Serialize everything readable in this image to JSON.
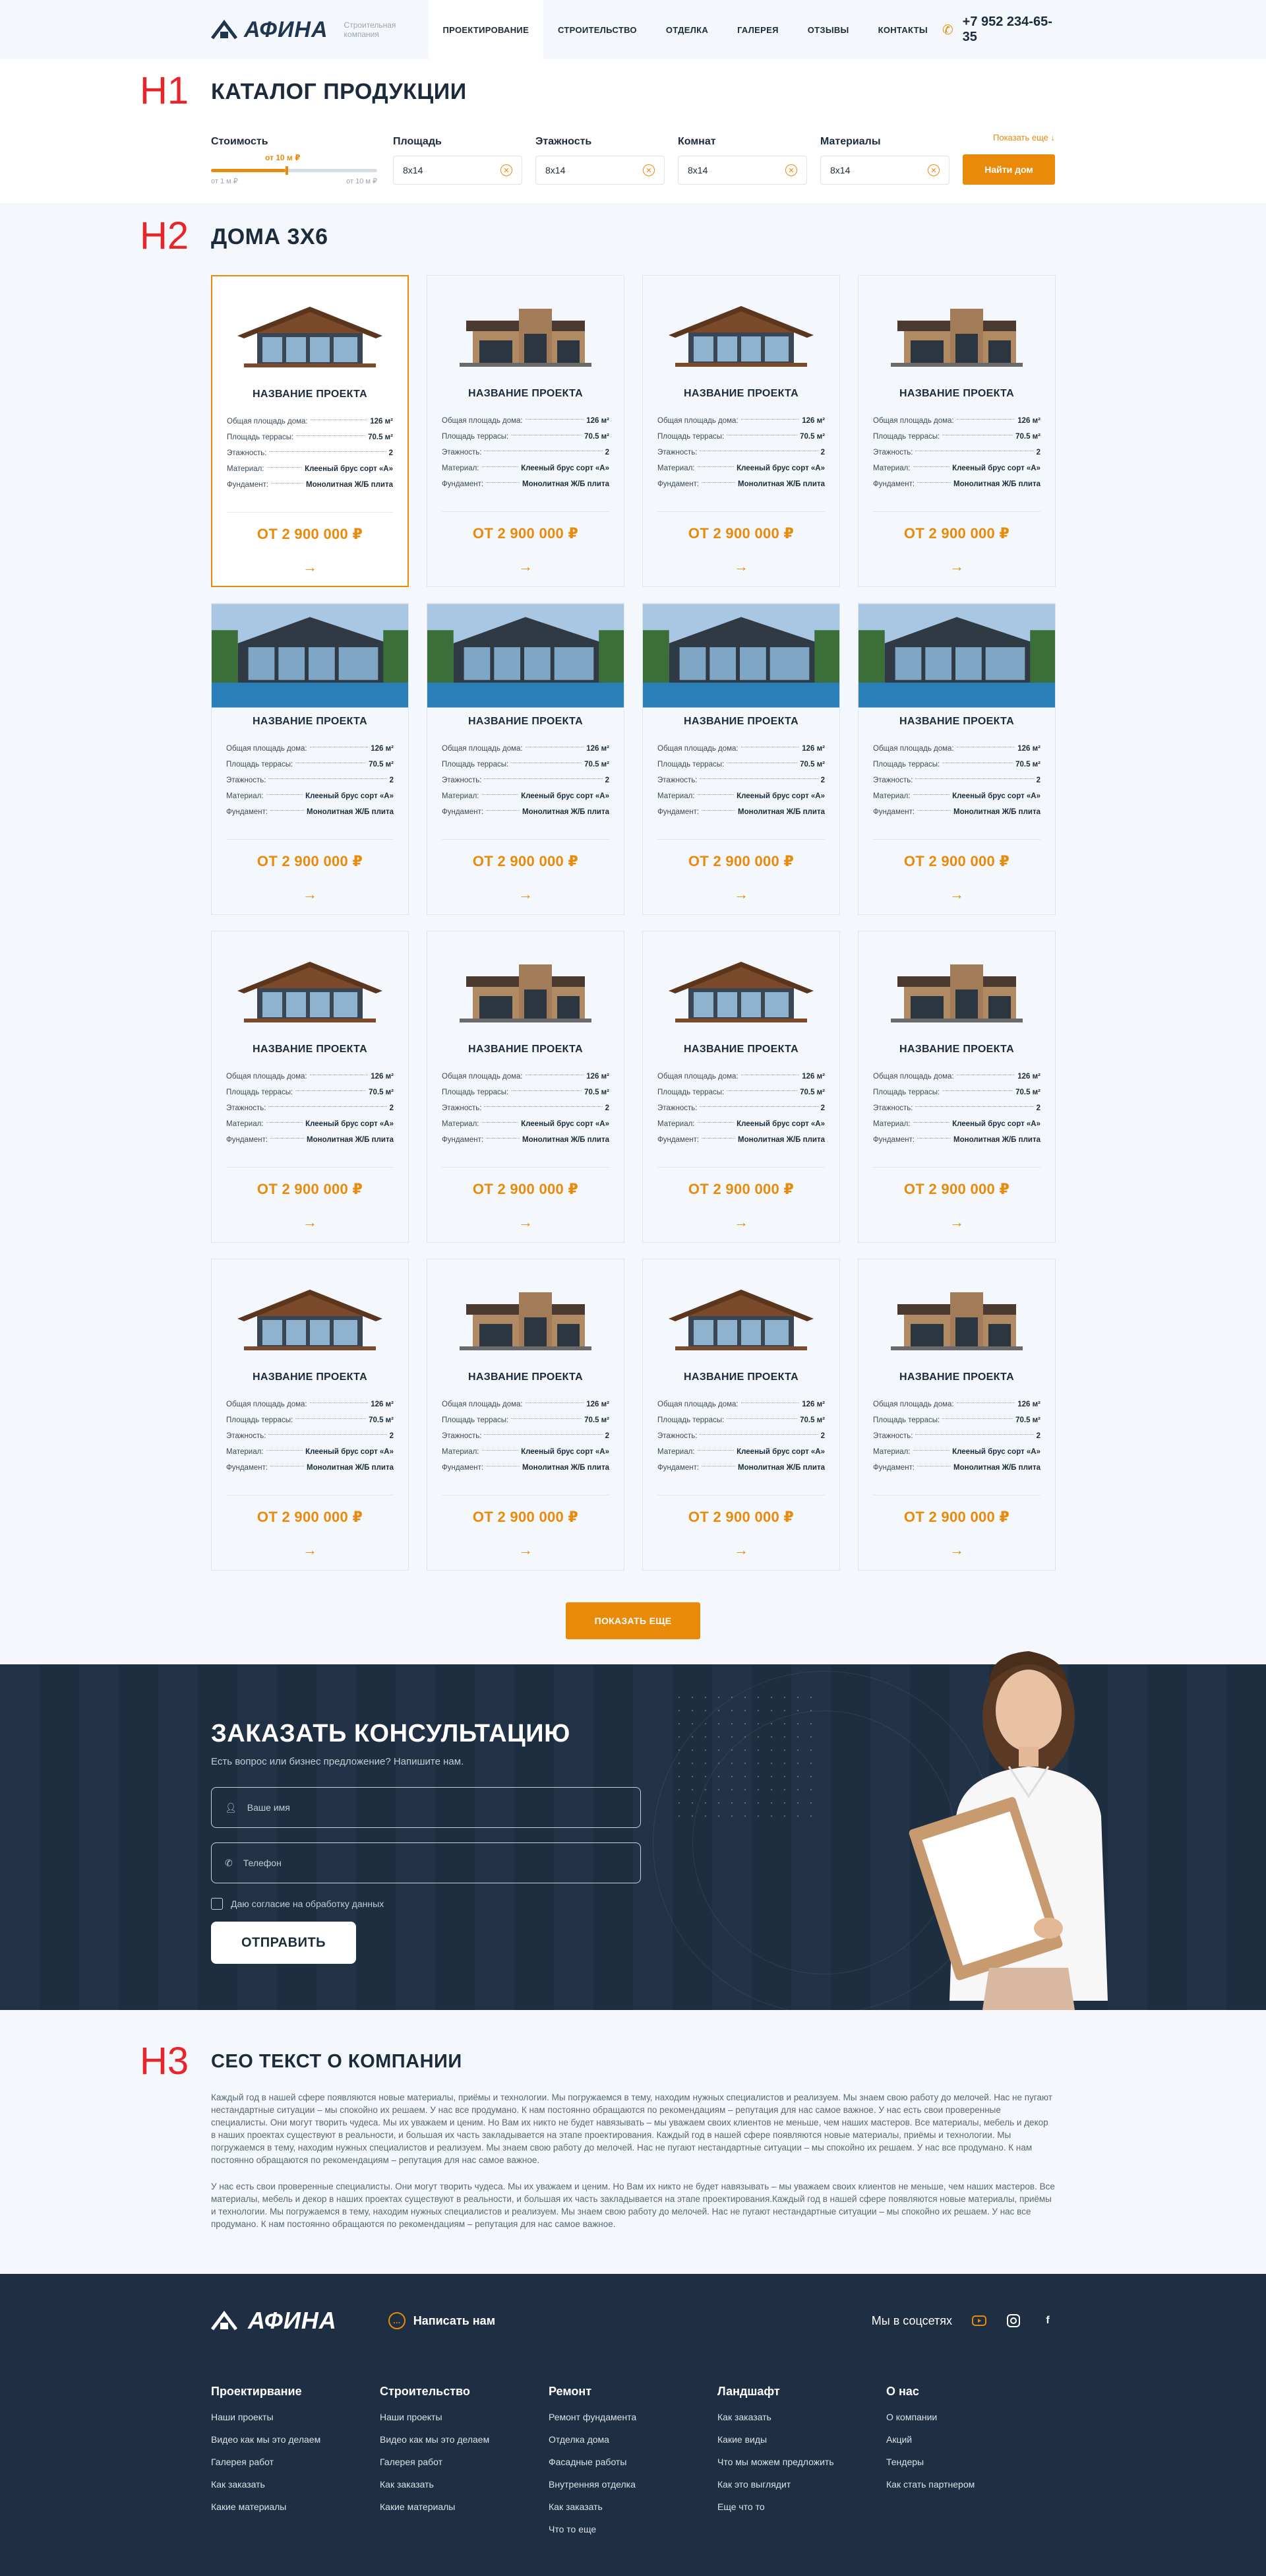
{
  "header": {
    "logo_text": "АФИНА",
    "logo_sub": "Строительная компания",
    "nav": [
      "ПРОЕКТИРОВАНИЕ",
      "СТРОИТЕЛЬСТВО",
      "ОТДЕЛКА",
      "ГАЛЕРЕЯ",
      "ОТЗЫВЫ",
      "КОНТАКТЫ"
    ],
    "phone": "+7 952 234-65-35"
  },
  "markers": {
    "h1": "H1",
    "h2": "H2",
    "h3": "H3"
  },
  "catalog": {
    "title": "КАТАЛОГ ПРОДУКЦИИ",
    "price_label": "Стоимость",
    "price_value": "от 10 м ₽",
    "price_min": "от 1 м ₽",
    "price_max": "от 10 м ₽",
    "filters": [
      {
        "label": "Площадь",
        "value": "8x14"
      },
      {
        "label": "Этажность",
        "value": "8x14"
      },
      {
        "label": "Комнат",
        "value": "8x14"
      },
      {
        "label": "Материалы",
        "value": "8x14"
      }
    ],
    "more_link": "Показать еще ↓",
    "find_button": "Найти дом"
  },
  "houses": {
    "title": "ДОМА 3Х6",
    "card": {
      "name": "НАЗВАНИЕ ПРОЕКТА",
      "specs": [
        {
          "k": "Общая площадь дома:",
          "v": "126 м²"
        },
        {
          "k": "Площадь террасы:",
          "v": "70.5 м²"
        },
        {
          "k": "Этажность:",
          "v": "2"
        },
        {
          "k": "Материал:",
          "v": "Клееный брус сорт «А»"
        },
        {
          "k": "Фундамент:",
          "v": "Монолитная Ж/Б плита"
        }
      ],
      "price": "ОТ 2 900 000 ₽",
      "arrow": "→"
    },
    "show_more": "ПОКАЗАТЬ ЕЩЕ"
  },
  "consult": {
    "title": "ЗАКАЗАТЬ КОНСУЛЬТАЦИЮ",
    "subtitle": "Есть вопрос или бизнес предложение? Напишите нам.",
    "name_placeholder": "Ваше имя",
    "phone_placeholder": "Телефон",
    "consent": "Даю согласие на обработку данных",
    "send": "ОТПРАВИТЬ"
  },
  "seo": {
    "title": "СЕО ТЕКСТ О КОМПАНИИ",
    "p1": "Каждый год в нашей сфере появляются новые материалы, приёмы и технологии. Мы погружаемся в тему, находим нужных специалистов и реализуем. Мы знаем свою работу до мелочей. Нас не пугают нестандартные ситуации – мы спокойно их решаем. У нас все продумано. К нам постоянно обращаются по рекомендациям – репутация для нас самое важное. У нас есть свои проверенные специалисты. Они могут творить чудеса. Мы их уважаем и ценим. Но Вам их никто не будет навязывать – мы уважаем своих клиентов не меньше, чем наших мастеров. Все материалы, мебель и декор в наших проектах существуют в реальности, и большая их часть закладывается на этапе проектирования. Каждый год в нашей сфере появляются новые материалы, приёмы и технологии. Мы погружаемся в тему, находим нужных специалистов и реализуем. Мы знаем свою работу до мелочей. Нас не пугают нестандартные ситуации – мы спокойно их решаем. У нас все продумано. К нам постоянно обращаются по рекомендациям – репутация для нас самое важное.",
    "p2": "У нас есть свои проверенные специалисты. Они могут творить чудеса. Мы их уважаем и ценим. Но Вам их никто не будет навязывать – мы уважаем своих клиентов не меньше, чем наших мастеров. Все материалы, мебель и декор в наших проектах существуют в реальности, и большая их часть закладывается на этапе проектирования.Каждый год в нашей сфере появляются новые материалы, приёмы и технологии. Мы погружаемся в тему, находим нужных специалистов и реализуем. Мы знаем свою работу до мелочей. Нас не пугают нестандартные ситуации – мы спокойно их решаем. У нас все продумано. К нам постоянно обращаются по рекомендациям – репутация для нас самое важное."
  },
  "footer": {
    "logo_text": "АФИНА",
    "write_us": "Написать нам",
    "social_label": "Мы в соцсетях",
    "columns": [
      {
        "title": "Проектирвание",
        "links": [
          "Наши проекты",
          "Видео как мы это делаем",
          "Галерея работ",
          "Как заказать",
          "Какие материалы"
        ]
      },
      {
        "title": "Строительство",
        "links": [
          "Наши проекты",
          "Видео как мы это делаем",
          "Галерея работ",
          "Как заказать",
          "Какие материалы"
        ]
      },
      {
        "title": "Ремонт",
        "links": [
          "Ремонт фундамента",
          "Отделка дома",
          "Фасадные работы",
          "Внутренняя отделка",
          "Как заказать",
          "Что то еще"
        ]
      },
      {
        "title": "Ландшафт",
        "links": [
          "Как заказать",
          "Какие виды",
          "Что мы можем предложить",
          "Как это выглядит",
          "Еще что то"
        ]
      },
      {
        "title": "О нас",
        "links": [
          "О компании",
          "Акций",
          "Тендеры",
          "Как стать партнером"
        ]
      }
    ]
  },
  "colors": {
    "accent": "#ea8a0b",
    "dark": "#1e2f43",
    "marker": "#e8252a"
  }
}
